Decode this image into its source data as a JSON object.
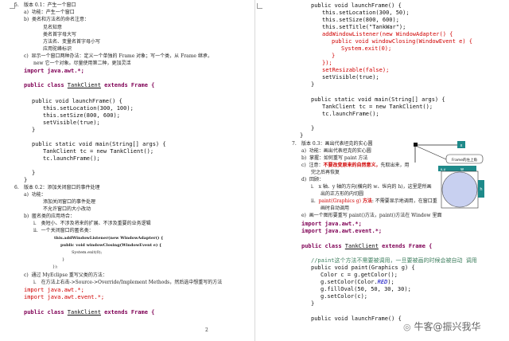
{
  "left": {
    "s5": {
      "title": "版本 0.1：产生一个窗口",
      "a": "功能：产生一个窗口",
      "b": "类名和方法名的命名注意：",
      "b1": "见名知意",
      "b2": "类名首字母大写",
      "b3": "方法名、变量名首字母小写",
      "b4": "应用驼峰标识",
      "c": "显示一个窗口两种办法：定义一个单独的 Frame 对象；写一个类，从 Frame 继承，",
      "c2": "new 它一个对象。尽量使用第二种，更加灵活"
    },
    "code1": {
      "import": "import java.awt.*;",
      "class_pre": "public class ",
      "class_name": "TankClient",
      "class_post": " extends Frame {",
      "m1": "public void launchFrame() {",
      "m2": "this.setLocation(300, 100);",
      "m3": "this.setSize(800, 600);",
      "m4": "setVisible(true);",
      "close1": "}",
      "main1": "public static void main(String[] args) {",
      "main2": "TankClient tc = new TankClient();",
      "main3": "tc.launchFrame();",
      "close2": "}",
      "close3": "}"
    },
    "s6": {
      "title": "版本 0.2：添加关闭窗口的事件处理",
      "a": "功能：",
      "a1": "添加关闭窗口的事件处理",
      "a2": "不允许窗口的大小改动",
      "b": "匿名类的应用场合：",
      "bi": "类短小、不涉及将来的扩展、不涉及重要的业务逻辑",
      "bii": "一个关闭窗口的匿名类：",
      "snip1": "this.addWindowListener(new WindowAdapter() {",
      "snip2": "public void windowClosing(WindowEvent e) {",
      "snip3": "System.exit(0);",
      "snip4": "}",
      "snip5": "});",
      "c": "通过 MyEclipse 重写父类的方法：",
      "ci": "在方法上右击->Source->Override/Implement Methods，然后选中想重写的方法"
    },
    "code2": {
      "imp1": "import java.awt.*;",
      "imp2": "import java.awt.event.*;",
      "class_pre": "public class ",
      "class_name": "TankClient",
      "class_post": " extends Frame {"
    },
    "page_number": "2"
  },
  "right": {
    "code3": {
      "l1": "public void launchFrame() {",
      "l2": "this.setLocation(300, 50);",
      "l3": "this.setSize(800, 600);",
      "l4": "this.setTitle(\"TankWar\");",
      "l5": "addWindowListener(new WindowAdapter() {",
      "l6": "public void windowClosing(WindowEvent e) {",
      "l7": "System.exit(0);",
      "l8": "}",
      "l9": "});",
      "l10": "setResizable(false);",
      "l11": "setVisible(true);",
      "l12": "}",
      "l13": "public static void main(String[] args) {",
      "l14": "TankClient tc = new TankClient();",
      "l15": "tc.launchFrame();",
      "l16": "}",
      "l17": "}"
    },
    "s7": {
      "title": "版本 0.3：画出代表坦克的实心圆",
      "a": "功能：画出代表坦克的实心圆",
      "b": "掌握：如何重写 paint 方法",
      "c_pre": "注意：",
      "c_red": "不要改变原来的自然意义，",
      "c_post": "先取出来，用",
      "c2": "完之后再恢复",
      "d": "回顾：",
      "di": "x 轴、y 轴的方向(横向的 w、纵向的 h)，这里是所画",
      "di2": "出的正方形的内切圆",
      "dii_pre": "paint(Graphics g) ",
      "dii_red": "方法",
      "dii_post": ": 不需要显示地调用，在窗口重",
      "dii2": "画时自动调用",
      "e": "画一个图形要重写 paint()方法，paint()方法在 Window 里面",
      "imp1": "import java.awt.*;",
      "imp2": "import java.awt.event.*;",
      "class_pre": "public class ",
      "class_name": "TankClient",
      "class_post": " extends Frame {",
      "cmt": "//paint这个方法不需要被调用，一旦要被画的时候会被自动 调用",
      "p1": "public void paint(Graphics g) {",
      "p2": "Color c = g.getColor();",
      "p3_pre": "g.setColor(Color.",
      "p3_it": "RED",
      "p3_post": ");",
      "p4": "g.fillOval(50, 50, 30, 30);",
      "p5": "g.setColor(c);",
      "p6": "}",
      "lf": "public void launchFrame() {"
    },
    "diagram": {
      "label_x": "x",
      "label_frame": "Frame的左上角",
      "label_xy": "x,y",
      "label_w": "w",
      "label_h": "h",
      "circle_color": "#c8d0f0"
    },
    "watermark": "牛客@振兴我华"
  }
}
